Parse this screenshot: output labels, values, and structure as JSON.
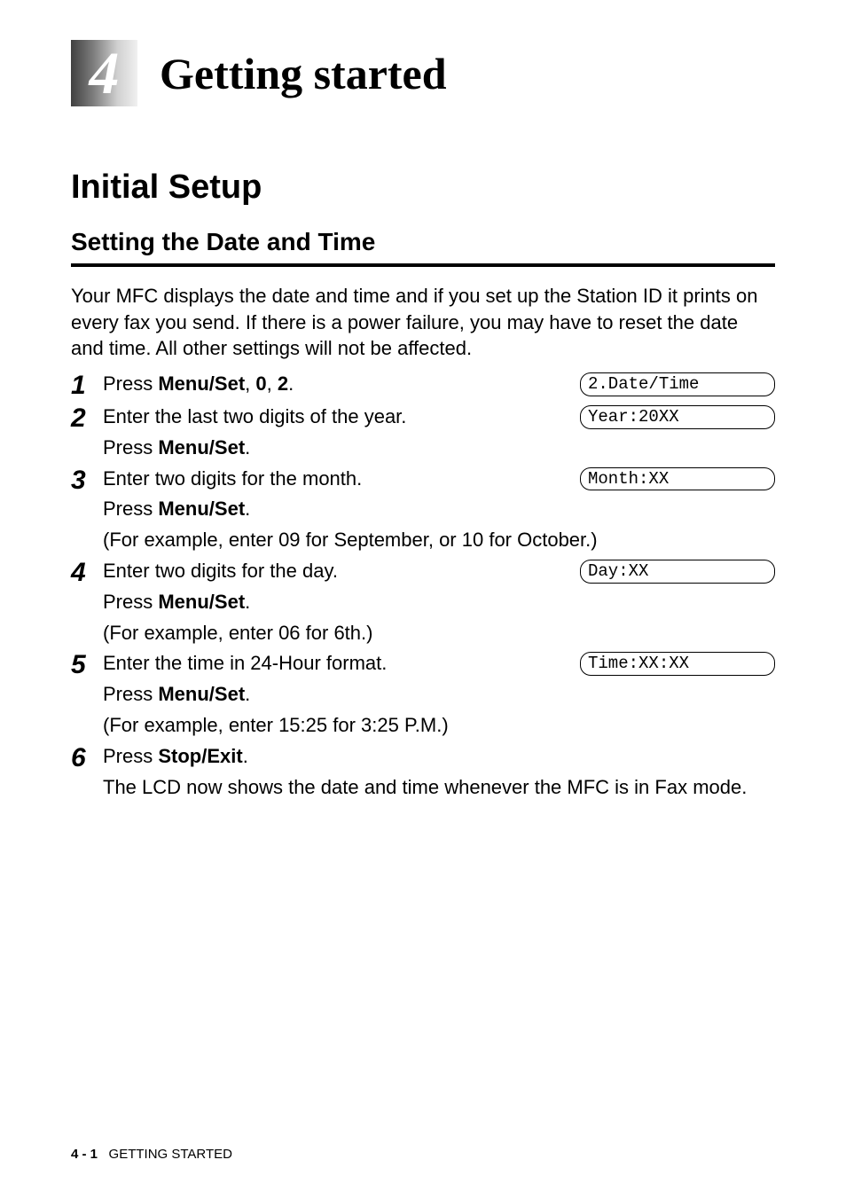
{
  "chapter": {
    "number": "4",
    "title": "Getting started"
  },
  "section": {
    "title": "Initial Setup"
  },
  "subsection": {
    "title": "Setting the Date and Time"
  },
  "intro": "Your MFC displays the date and time and if you set up the Station ID it prints on every fax you send. If there is a power failure, you may have to reset the date and time. All other settings will not be affected.",
  "steps": {
    "s1": {
      "num": "1",
      "text_pre": "Press ",
      "key1": "Menu/Set",
      "sep1": ", ",
      "key2": "0",
      "sep2": ", ",
      "key3": "2",
      "text_post": ".",
      "lcd": "2.Date/Time"
    },
    "s2": {
      "num": "2",
      "text": "Enter the last two digits of the year.",
      "sub_pre": "Press ",
      "sub_key": "Menu/Set",
      "sub_post": ".",
      "lcd": "Year:20XX"
    },
    "s3": {
      "num": "3",
      "text": "Enter two digits for the month.",
      "sub_pre": "Press ",
      "sub_key": "Menu/Set",
      "sub_post": ".",
      "example": "(For example, enter 09 for September, or 10 for October.)",
      "lcd": "Month:XX"
    },
    "s4": {
      "num": "4",
      "text": "Enter two digits for the day.",
      "sub_pre": "Press ",
      "sub_key": "Menu/Set",
      "sub_post": ".",
      "example": "(For example, enter 06 for 6th.)",
      "lcd": "Day:XX"
    },
    "s5": {
      "num": "5",
      "text": "Enter the time in 24-Hour format.",
      "sub_pre": "Press ",
      "sub_key": "Menu/Set",
      "sub_post": ".",
      "example": "(For example, enter 15:25 for 3:25 P.M.)",
      "lcd": "Time:XX:XX"
    },
    "s6": {
      "num": "6",
      "text_pre": "Press ",
      "key": "Stop/Exit",
      "text_post": ".",
      "note": "The LCD now shows the date and time whenever the MFC is in Fax mode."
    }
  },
  "footer": {
    "page": "4 - 1",
    "label": "GETTING STARTED"
  }
}
